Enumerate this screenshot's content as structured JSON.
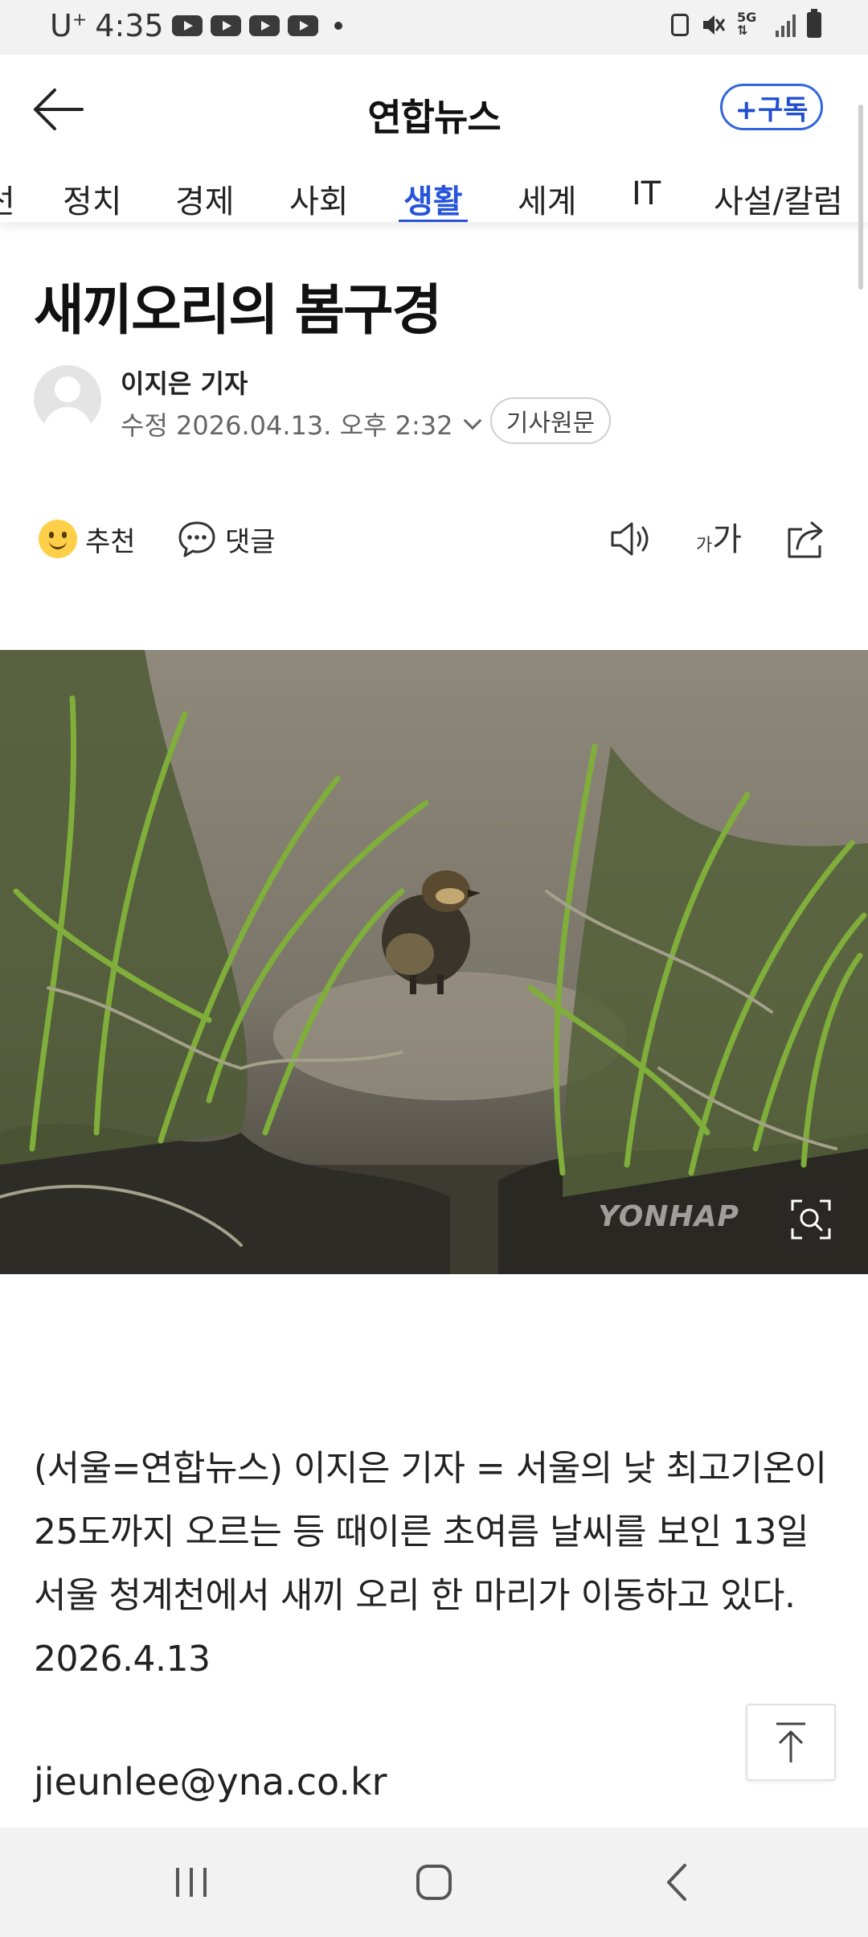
{
  "status_bar": {
    "carrier": "U",
    "carrier_sup": "+",
    "time": "4:35",
    "network": "5G"
  },
  "header": {
    "title": "연합뉴스",
    "subscribe_label": "+구독",
    "tabs": [
      {
        "label": "선",
        "active": false
      },
      {
        "label": "정치",
        "active": false
      },
      {
        "label": "경제",
        "active": false
      },
      {
        "label": "사회",
        "active": false
      },
      {
        "label": "생활",
        "active": true
      },
      {
        "label": "세계",
        "active": false
      },
      {
        "label": "IT",
        "active": false
      },
      {
        "label": "사설/칼럼",
        "active": false
      }
    ]
  },
  "article": {
    "headline": "새끼오리의 봄구경",
    "author": "이지은 기자",
    "modified": "수정 2026.04.13. 오후 2:32",
    "original_label": "기사원문",
    "actions": {
      "recommend_label": "추천",
      "comment_label": "댓글",
      "font_small": "가",
      "font_large": "가"
    },
    "photo_watermark": "YONHAP",
    "body": "(서울=연합뉴스) 이지은 기자 = 서울의 낮 최고기온이 25도까지 오르는 등 때이른 초여름 날씨를 보인 13일 서울 청계천에서 새끼 오리 한 마리가 이동하고 있다. 2026.4.13",
    "email": "jieunlee@yna.co.kr"
  },
  "colors": {
    "accent": "#2755d9",
    "status_bar_bg": "#f2f2f2",
    "nav_bar_bg": "#f2f2f2"
  },
  "icons": {
    "back": "arrow-left-icon",
    "speaker": "speaker-icon",
    "share": "share-icon",
    "zoom": "zoom-icon",
    "top": "arrow-up-icon"
  }
}
